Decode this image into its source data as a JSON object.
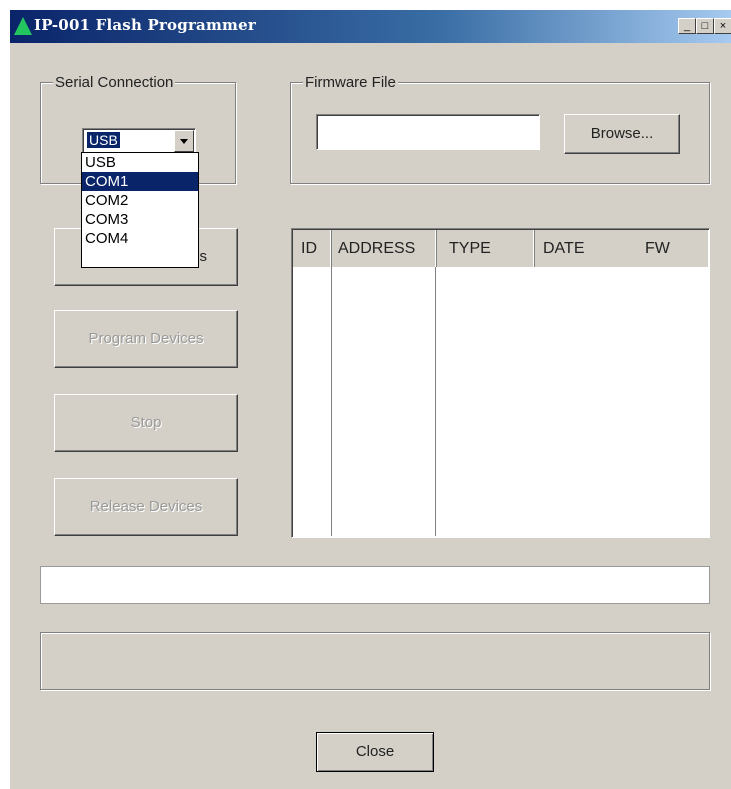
{
  "window": {
    "title": "IP-001 Flash Programmer",
    "controls": {
      "minimize": "_",
      "maximize": "□",
      "close": "×"
    }
  },
  "serial_connection": {
    "label": "Serial Connection",
    "selected": "USB",
    "options": [
      "USB",
      "COM1",
      "COM2",
      "COM3",
      "COM4"
    ],
    "highlighted": "COM1"
  },
  "firmware_file": {
    "label": "Firmware File",
    "path_value": "",
    "browse_label": "Browse..."
  },
  "actions": {
    "find_devices_partial": "s",
    "program_devices": "Program Devices",
    "stop": "Stop",
    "release_devices": "Release Devices"
  },
  "device_list": {
    "columns": [
      "ID",
      "ADDRESS",
      "TYPE",
      "DATE",
      "FW"
    ],
    "rows": []
  },
  "status_text": "",
  "info_text": "",
  "close_label": "Close",
  "colors": {
    "face": "#d4d0c8",
    "titlebar_start": "#0a246a",
    "selection": "#0a246a",
    "icon": "#22c55e"
  }
}
